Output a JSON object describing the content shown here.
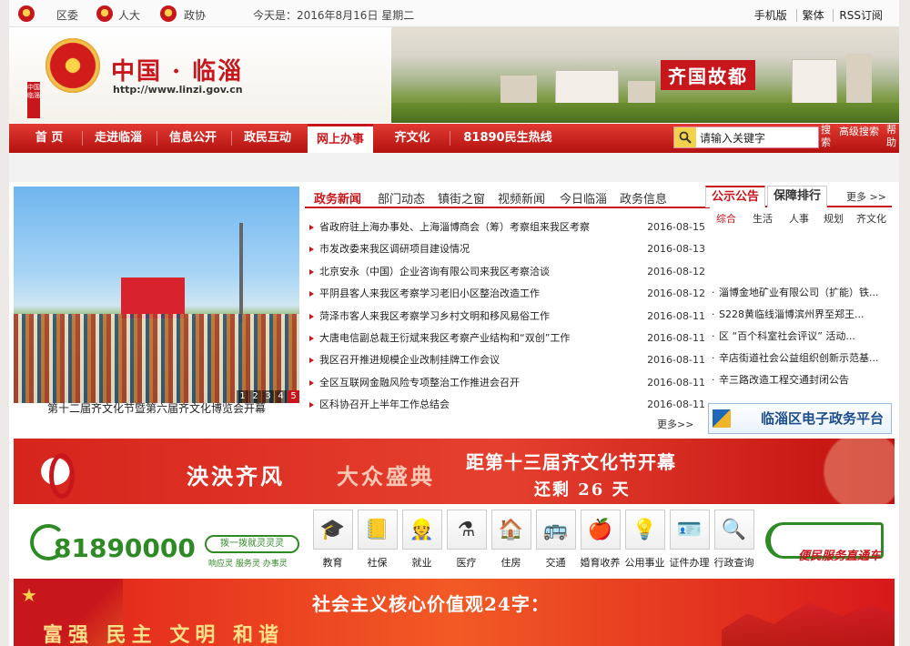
{
  "topbar": {
    "links_left": [
      "区委",
      "人大",
      "政协"
    ],
    "date_text": "今天是：2016年8月16日 星期二",
    "links_right": [
      "手机版",
      "繁体",
      "RSS订阅"
    ]
  },
  "header": {
    "title": "中国 · 临淄",
    "url": "http://www.linzi.gov.cn",
    "vertical_tag": "中国临淄",
    "banner_slogan": "齐国故都"
  },
  "nav": {
    "items": [
      "首 页",
      "走进临淄",
      "信息公开",
      "政民互动",
      "网上办事",
      "齐文化",
      "81890民生热线"
    ],
    "active_index": 4,
    "search_placeholder": "请输入关键字",
    "search_button": "搜索",
    "advanced_search": "高级搜索",
    "help": "帮助"
  },
  "slider": {
    "caption": "第十二届齐文化节暨第六届齐文化博览会开幕",
    "pages": [
      "1",
      "2",
      "3",
      "4",
      "5"
    ],
    "active_page": 4
  },
  "news": {
    "tabs": [
      "政务新闻",
      "部门动态",
      "镇街之窗",
      "视频新闻",
      "今日临淄",
      "政务信息"
    ],
    "active_tab": 0,
    "items": [
      {
        "title": "省政府驻上海办事处、上海淄博商会（筹）考察组来我区考察",
        "date": "2016-08-15"
      },
      {
        "title": "市发改委来我区调研项目建设情况",
        "date": "2016-08-13"
      },
      {
        "title": "北京安永（中国）企业咨询有限公司来我区考察洽谈",
        "date": "2016-08-12"
      },
      {
        "title": "平阴县客人来我区考察学习老旧小区整治改造工作",
        "date": "2016-08-12"
      },
      {
        "title": "菏泽市客人来我区考察学习乡村文明和移风易俗工作",
        "date": "2016-08-11"
      },
      {
        "title": "大唐电信副总裁王衍斌来我区考察产业结构和“双创”工作",
        "date": "2016-08-11"
      },
      {
        "title": "我区召开推进规模企业改制挂牌工作会议",
        "date": "2016-08-11"
      },
      {
        "title": "全区互联网金融风险专项整治工作推进会召开",
        "date": "2016-08-11"
      },
      {
        "title": "区科协召开上半年工作总结会",
        "date": "2016-08-11"
      }
    ],
    "more": "更多>>"
  },
  "notice": {
    "tabs": [
      "公示公告",
      "保障排行"
    ],
    "more": "更多 >>",
    "categories": [
      "综合",
      "生活",
      "人事",
      "规划",
      "齐文化"
    ],
    "items": [
      "淄博金地矿业有限公司（扩能）铁...",
      "S228黄临线淄博滨州界至郑王...",
      "区 “百个科室社会评议” 活动...",
      "辛店街道社会公益组织创新示范基...",
      "辛三路改造工程交通封闭公告"
    ],
    "platform": "临淄区电子政务平台"
  },
  "festival": {
    "slogan1": "泱泱齐风",
    "slogan2": "大众盛典",
    "countdown_title": "距第十三届齐文化节开幕",
    "countdown_text": "还剩 26 天"
  },
  "service": {
    "hotline_number": "81890000",
    "hotline_bubble": "拨一拨就灵灵灵",
    "hotline_tags": "响应灵 服务灵 办事灵",
    "items": [
      {
        "label": "教育",
        "icon": "graduation-cap-icon"
      },
      {
        "label": "社保",
        "icon": "notebook-icon"
      },
      {
        "label": "就业",
        "icon": "worker-icon"
      },
      {
        "label": "医疗",
        "icon": "flask-icon"
      },
      {
        "label": "住房",
        "icon": "house-icon"
      },
      {
        "label": "交通",
        "icon": "bus-icon"
      },
      {
        "label": "婚育收养",
        "icon": "apple-icon"
      },
      {
        "label": "公用事业",
        "icon": "lightbulb-icon"
      },
      {
        "label": "证件办理",
        "icon": "id-card-icon"
      },
      {
        "label": "行政查询",
        "icon": "magnifier-icon"
      }
    ],
    "express_text": "便民服务直通车"
  },
  "values_banner": {
    "title": "社会主义核心价值观24字：",
    "words": "富强 民主 文明 和谐"
  }
}
